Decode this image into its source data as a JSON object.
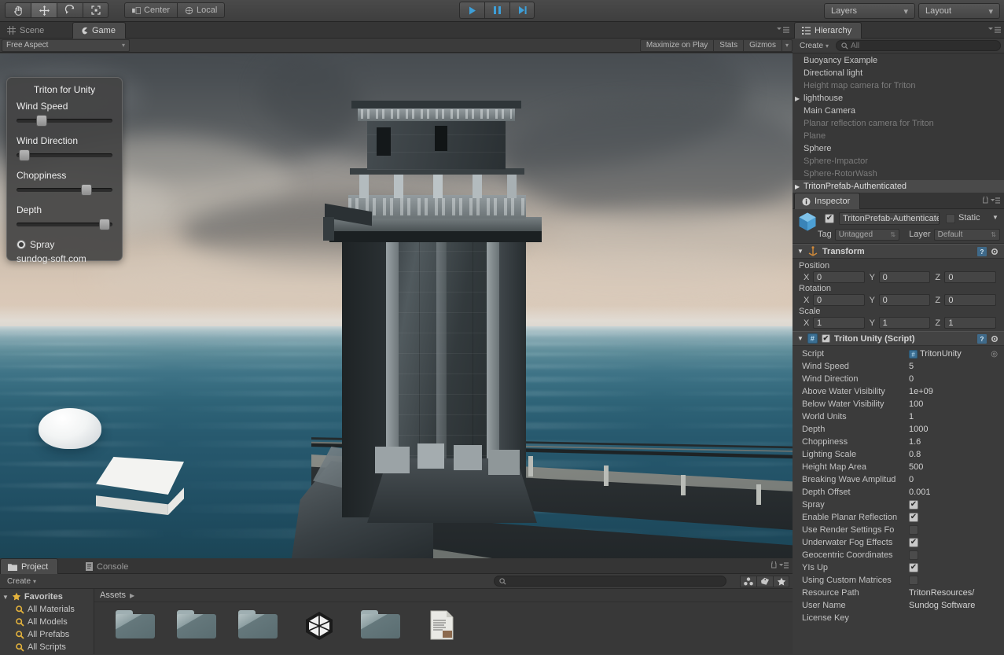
{
  "toolbar": {
    "tools": [
      {
        "name": "hand-tool",
        "label": "Hand"
      },
      {
        "name": "move-tool",
        "label": "Move"
      },
      {
        "name": "rotate-tool",
        "label": "Rotate"
      },
      {
        "name": "scale-tool",
        "label": "Scale"
      }
    ],
    "pivot_mode": "Center",
    "pivot_space": "Local",
    "play_label": "Play",
    "pause_label": "Pause",
    "step_label": "Step",
    "layers_label": "Layers",
    "layout_label": "Layout",
    "caret": "▾"
  },
  "game_panel": {
    "tabs": [
      {
        "label": "Scene",
        "active": false
      },
      {
        "label": "Game",
        "active": true
      }
    ],
    "aspect": "Free Aspect",
    "maximize_on_play": "Maximize on Play",
    "stats": "Stats",
    "gizmos": "Gizmos"
  },
  "triton_overlay": {
    "title": "Triton for Unity",
    "sliders": [
      {
        "label": "Wind Speed",
        "percent": 23
      },
      {
        "label": "Wind Direction",
        "percent": 3
      },
      {
        "label": "Choppiness",
        "percent": 76
      },
      {
        "label": "Depth",
        "percent": 97
      }
    ],
    "spray_label": "Spray",
    "spray_checked": true,
    "url": "sundog-soft.com"
  },
  "hierarchy": {
    "tab_label": "Hierarchy",
    "create_label": "Create",
    "search_placeholder": "All",
    "items": [
      {
        "label": "Buoyancy Example",
        "state": "norm",
        "expandable": false
      },
      {
        "label": "Directional light",
        "state": "norm",
        "expandable": false
      },
      {
        "label": "Height map camera for Triton",
        "state": "dim",
        "expandable": false
      },
      {
        "label": "lighthouse",
        "state": "norm",
        "expandable": true
      },
      {
        "label": "Main Camera",
        "state": "norm",
        "expandable": false
      },
      {
        "label": "Planar reflection camera for Triton",
        "state": "dim",
        "expandable": false
      },
      {
        "label": "Plane",
        "state": "dim",
        "expandable": false
      },
      {
        "label": "Sphere",
        "state": "norm",
        "expandable": false
      },
      {
        "label": "Sphere-Impactor",
        "state": "dim",
        "expandable": false
      },
      {
        "label": "Sphere-RotorWash",
        "state": "dim",
        "expandable": false
      },
      {
        "label": "TritonPrefab-Authenticated",
        "state": "sel",
        "expandable": true
      }
    ]
  },
  "inspector": {
    "tab_label": "Inspector",
    "object_name": "TritonPrefab-Authenticate",
    "object_enabled": true,
    "static_label": "Static",
    "static_checked": false,
    "tag_label": "Tag",
    "tag_value": "Untagged",
    "layer_label": "Layer",
    "layer_value": "Default",
    "transform": {
      "title": "Transform",
      "position_label": "Position",
      "rotation_label": "Rotation",
      "scale_label": "Scale",
      "position": {
        "x": "0",
        "y": "0",
        "z": "0"
      },
      "rotation": {
        "x": "0",
        "y": "0",
        "z": "0"
      },
      "scale": {
        "x": "1",
        "y": "1",
        "z": "1"
      },
      "axes": {
        "x": "X",
        "y": "Y",
        "z": "Z"
      }
    },
    "triton_script": {
      "title": "Triton Unity (Script)",
      "enabled": true,
      "properties": [
        {
          "name": "Script",
          "value": "TritonUnity",
          "type": "object"
        },
        {
          "name": "Wind Speed",
          "value": "5",
          "type": "text"
        },
        {
          "name": "Wind Direction",
          "value": "0",
          "type": "text"
        },
        {
          "name": "Above Water Visibility",
          "value": "1e+09",
          "type": "text"
        },
        {
          "name": "Below Water Visibility",
          "value": "100",
          "type": "text"
        },
        {
          "name": "World Units",
          "value": "1",
          "type": "text"
        },
        {
          "name": "Depth",
          "value": "1000",
          "type": "text"
        },
        {
          "name": "Choppiness",
          "value": "1.6",
          "type": "text"
        },
        {
          "name": "Lighting Scale",
          "value": "0.8",
          "type": "text"
        },
        {
          "name": "Height Map Area",
          "value": "500",
          "type": "text"
        },
        {
          "name": "Breaking Wave Amplitud",
          "value": "0",
          "type": "text"
        },
        {
          "name": "Depth Offset",
          "value": "0.001",
          "type": "text"
        },
        {
          "name": "Spray",
          "value": true,
          "type": "check"
        },
        {
          "name": "Enable Planar Reflection",
          "value": true,
          "type": "check"
        },
        {
          "name": "Use Render Settings Fo",
          "value": false,
          "type": "check"
        },
        {
          "name": "Underwater Fog Effects",
          "value": true,
          "type": "check"
        },
        {
          "name": "Geocentric Coordinates",
          "value": false,
          "type": "check"
        },
        {
          "name": "YIs Up",
          "value": true,
          "type": "check"
        },
        {
          "name": "Using Custom Matrices",
          "value": false,
          "type": "check"
        },
        {
          "name": "Resource Path",
          "value": "TritonResources/",
          "type": "text"
        },
        {
          "name": "User Name",
          "value": "Sundog Software",
          "type": "text"
        },
        {
          "name": "License Key",
          "value": "",
          "type": "password"
        }
      ]
    }
  },
  "project": {
    "tabs": [
      {
        "label": "Project",
        "active": true
      },
      {
        "label": "Console",
        "active": false
      }
    ],
    "create_label": "Create",
    "breadcrumb": "Assets",
    "favorites_label": "Favorites",
    "favorites": [
      {
        "label": "All Materials"
      },
      {
        "label": "All Models"
      },
      {
        "label": "All Prefabs"
      },
      {
        "label": "All Scripts"
      }
    ],
    "assets": [
      {
        "kind": "folder"
      },
      {
        "kind": "folder"
      },
      {
        "kind": "folder"
      },
      {
        "kind": "unity-scene"
      },
      {
        "kind": "folder"
      },
      {
        "kind": "text-file"
      }
    ]
  },
  "colors": {
    "accent_blue": "#3d9fd8",
    "panel_bg": "#3b3b3b",
    "toolbar_bg": "#4a4a4a",
    "selection": "#4a4a4a",
    "water_deep": "#1b4556",
    "water_near": "#2e6377",
    "sky_top": "#4e5358",
    "sky_horizon": "#dccbba",
    "folder": "#65787c"
  }
}
